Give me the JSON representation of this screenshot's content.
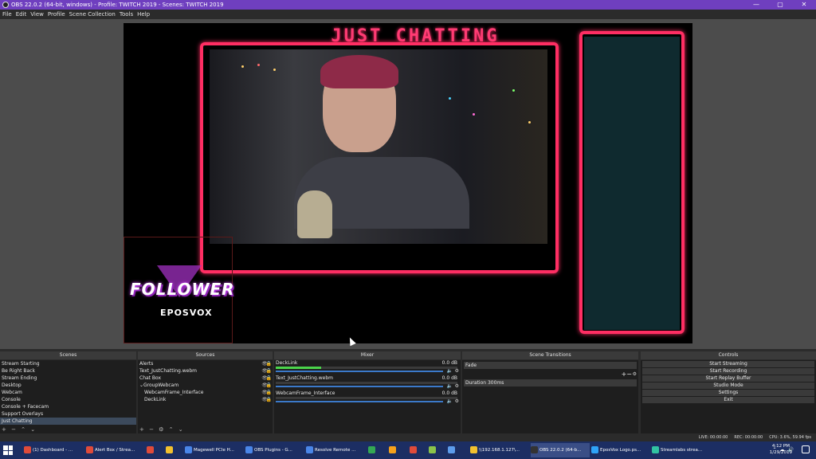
{
  "window": {
    "title": "OBS 22.0.2 (64-bit, windows) - Profile: TWITCH 2019 - Scenes: TWITCH 2019",
    "minimize": "—",
    "maximize": "▢",
    "close": "✕"
  },
  "menu": [
    "File",
    "Edit",
    "View",
    "Profile",
    "Scene Collection",
    "Tools",
    "Help"
  ],
  "preview": {
    "scene_title": "JUST CHATTING",
    "follower_text": "FOLLOWER",
    "brand_text": "EPOSVOX"
  },
  "docks": {
    "scenes": {
      "title": "Scenes",
      "items": [
        "Stream Starting",
        "Be Right Back",
        "Stream Ending",
        "Desktop",
        "Webcam",
        "Console",
        "Console + Facecam",
        "Support Overlays",
        "Just Chatting"
      ],
      "selected": "Just Chatting",
      "footer": "+ − ⌃ ⌄"
    },
    "sources": {
      "title": "Sources",
      "items": [
        "Alerts",
        "Text_JustChatting.webm",
        "Chat Box",
        "GroupWebcam",
        "WebcamFrame_Interface",
        "DeckLink"
      ],
      "footer": "+ − ⚙ ⌃ ⌄"
    },
    "mixer": {
      "title": "Mixer",
      "channels": [
        {
          "name": "DeckLink",
          "db": "0.0 dB",
          "level": 0.25
        },
        {
          "name": "Text_JustChatting.webm",
          "db": "0.0 dB",
          "level": 0
        },
        {
          "name": "WebcamFrame_Interface",
          "db": "0.0 dB",
          "level": 0
        }
      ]
    },
    "transitions": {
      "title": "Scene Transitions",
      "selected": "Fade",
      "duration_label": "Duration",
      "duration_value": "300ms"
    },
    "controls": {
      "title": "Controls",
      "buttons": [
        "Start Streaming",
        "Start Recording",
        "Start Replay Buffer",
        "Studio Mode",
        "Settings",
        "Exit"
      ]
    }
  },
  "status": {
    "live": "LIVE: 00:00:00",
    "rec": "REC: 00:00:00",
    "cpu": "CPU: 3.6%, 59.94 fps"
  },
  "taskbar": {
    "items": [
      {
        "label": "(1) Dashboard - ...",
        "icon": "chrome-icon",
        "color": "#e04b3a"
      },
      {
        "label": "Alert Box / Strea...",
        "icon": "chrome-icon",
        "color": "#e04b3a"
      },
      {
        "label": "",
        "icon": "chrome-icon",
        "color": "#e04b3a"
      },
      {
        "label": "",
        "icon": "sticky-notes-icon",
        "color": "#f2c12e"
      },
      {
        "label": "Magewell PCIe H...",
        "icon": "docs-icon",
        "color": "#4a86e8"
      },
      {
        "label": "OBS Plugins - G...",
        "icon": "docs-icon",
        "color": "#4a86e8"
      },
      {
        "label": "Resolve Remote ...",
        "icon": "docs-icon",
        "color": "#4a86e8"
      },
      {
        "label": "",
        "icon": "sheets-icon",
        "color": "#34a853"
      },
      {
        "label": "",
        "icon": "app-icon",
        "color": "#f7a21b"
      },
      {
        "label": "",
        "icon": "app-icon",
        "color": "#e04b3a"
      },
      {
        "label": "",
        "icon": "app-icon",
        "color": "#8bc34a"
      },
      {
        "label": "",
        "icon": "app-icon",
        "color": "#5d9cec"
      },
      {
        "label": "\\\\192.168.1.127\\...",
        "icon": "folder-icon",
        "color": "#f2c12e"
      },
      {
        "label": "OBS 22.0.2 (64-b...",
        "icon": "obs-icon",
        "color": "#333333"
      },
      {
        "label": "EposVox Logo.ps...",
        "icon": "photoshop-icon",
        "color": "#2fa3f7"
      },
      {
        "label": "Streamlabs strea...",
        "icon": "streamlabs-icon",
        "color": "#31c3a2"
      }
    ],
    "clock_time": "4:12 PM",
    "clock_date": "1/29/2019"
  }
}
